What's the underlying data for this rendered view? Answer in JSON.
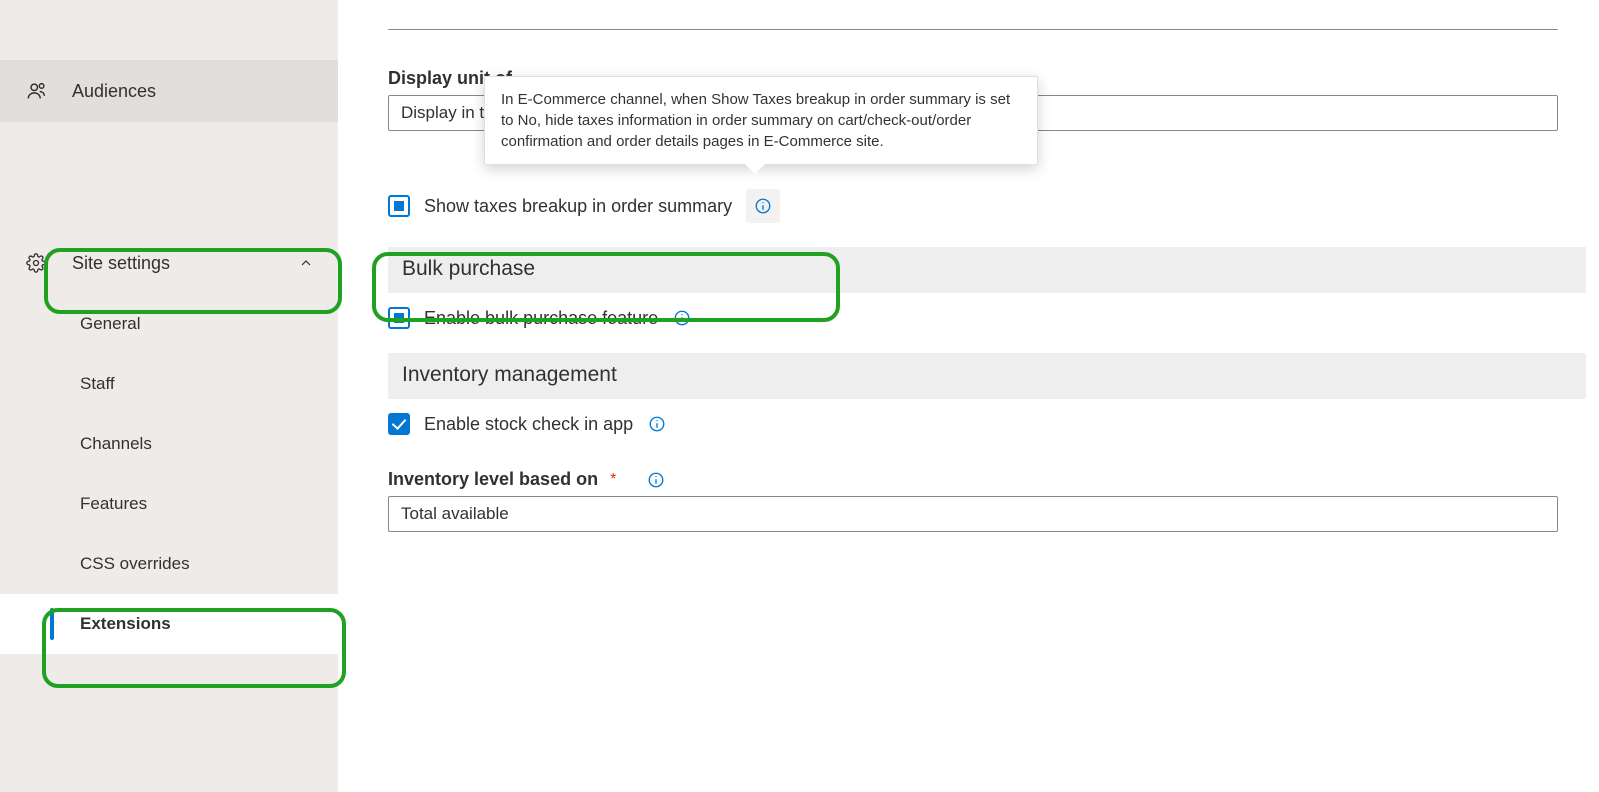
{
  "sidebar": {
    "audiences": "Audiences",
    "site_settings": "Site settings",
    "items": {
      "general": "General",
      "staff": "Staff",
      "channels": "Channels",
      "features": "Features",
      "css_overrides": "CSS overrides",
      "extensions": "Extensions"
    }
  },
  "main": {
    "display_unit_label": "Display unit of ",
    "display_unit_value": "Display in the ",
    "tooltip_text": "In E-Commerce channel, when Show Taxes breakup in order summary is set to No, hide taxes information in order summary on cart/check-out/order confirmation and order details pages in E-Commerce site.",
    "show_taxes_label": "Show taxes breakup in order summary",
    "bulk_header": "Bulk purchase",
    "bulk_label": "Enable bulk purchase feature",
    "inv_header": "Inventory management",
    "inv_label": "Enable stock check in app",
    "inv_level_label": "Inventory level based on",
    "inv_level_value": "Total available"
  }
}
